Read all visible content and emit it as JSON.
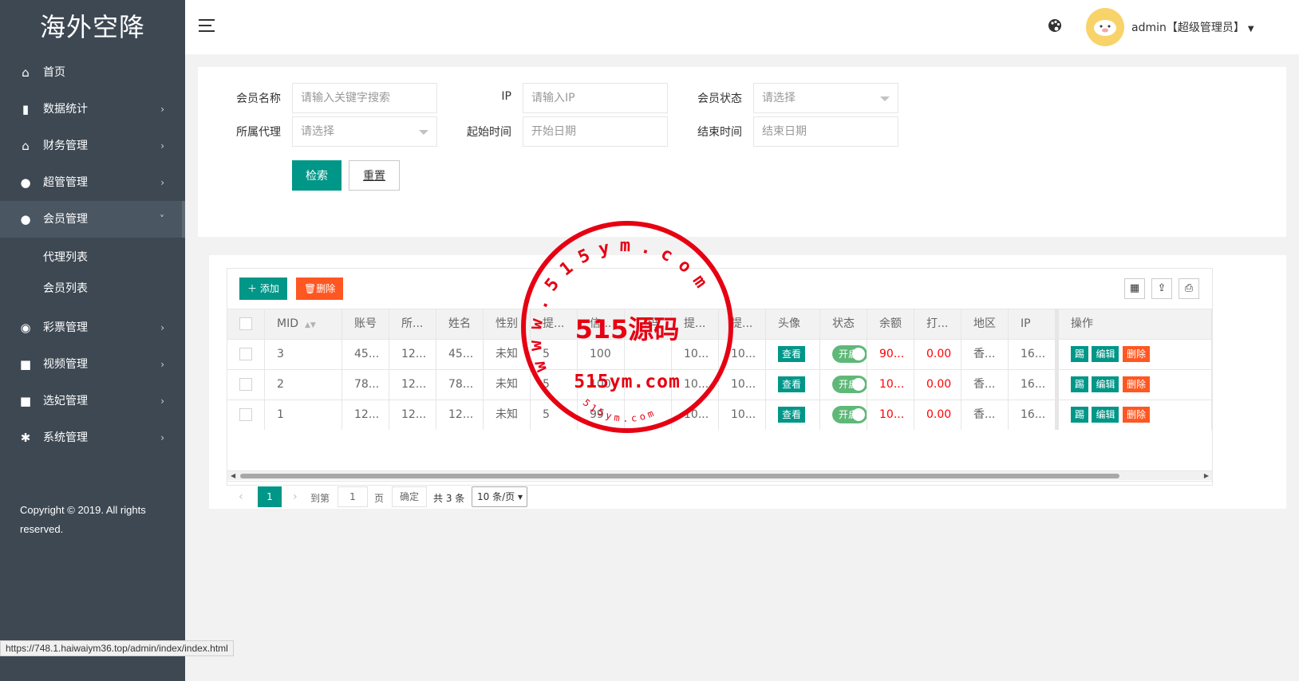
{
  "sidebar": {
    "brand": "海外空降",
    "items": [
      {
        "label": "首页",
        "icon": "home-icon",
        "glyph": "⌂"
      },
      {
        "label": "数据统计",
        "icon": "bar-chart-icon",
        "glyph": "▮"
      },
      {
        "label": "财务管理",
        "icon": "bank-icon",
        "glyph": "⌂"
      },
      {
        "label": "超管管理",
        "icon": "user-icon",
        "glyph": "●"
      },
      {
        "label": "会员管理",
        "icon": "users-icon",
        "glyph": "●"
      },
      {
        "label": "彩票管理",
        "icon": "gamepad-icon",
        "glyph": "◉"
      },
      {
        "label": "视频管理",
        "icon": "video-icon",
        "glyph": "■"
      },
      {
        "label": "选妃管理",
        "icon": "video-icon",
        "glyph": "■"
      },
      {
        "label": "系统管理",
        "icon": "gear-icon",
        "glyph": "✱"
      }
    ],
    "sub_items": [
      "代理列表",
      "会员列表"
    ],
    "copyright": "Copyright © 2019. All rights reserved."
  },
  "topbar": {
    "user": "admin【超级管理员】"
  },
  "search": {
    "member_name_label": "会员名称",
    "member_name_placeholder": "请输入关键字搜索",
    "ip_label": "IP",
    "ip_placeholder": "请输入IP",
    "status_label": "会员状态",
    "status_value": "请选择",
    "agent_label": "所属代理",
    "agent_value": "请选择",
    "start_label": "起始时间",
    "start_placeholder": "开始日期",
    "end_label": "结束时间",
    "end_placeholder": "结束日期",
    "search_button": "检索",
    "reset_button": "重置"
  },
  "table": {
    "add_button": "添加",
    "delete_button": "删除",
    "columns": [
      "MID",
      "账号",
      "所...",
      "姓名",
      "性别",
      "提...",
      "信...",
      "...码",
      "提...",
      "提...",
      "头像",
      "状态",
      "余额",
      "打...",
      "地区",
      "IP",
      "操作"
    ],
    "rows": [
      {
        "mid": "3",
        "account": "45...",
        "agent": "12...",
        "name": "45...",
        "gender": "未知",
        "c5": "5",
        "credit": "100",
        "c7": "",
        "c8": "10...",
        "c9": "10...",
        "avatar_btn": "查看",
        "status": "开启",
        "balance": "90...",
        "bet": "0.00",
        "region": "香...",
        "ip": "16..."
      },
      {
        "mid": "2",
        "account": "78...",
        "agent": "12...",
        "name": "78...",
        "gender": "未知",
        "c5": "5",
        "credit": "100",
        "c7": "",
        "c8": "10...",
        "c9": "10...",
        "avatar_btn": "查看",
        "status": "开启",
        "balance": "10...",
        "bet": "0.00",
        "region": "香...",
        "ip": "16..."
      },
      {
        "mid": "1",
        "account": "12...",
        "agent": "12...",
        "name": "12...",
        "gender": "未知",
        "c5": "5",
        "credit": "99",
        "c7": "",
        "c8": "10...",
        "c9": "10...",
        "avatar_btn": "查看",
        "status": "开启",
        "balance": "10...",
        "bet": "0.00",
        "region": "香...",
        "ip": "16..."
      }
    ],
    "row_actions": [
      "踢",
      "编辑",
      "删除"
    ]
  },
  "pager": {
    "current": "1",
    "goto_label": "到第",
    "page_input": "1",
    "page_unit": "页",
    "confirm": "确定",
    "total": "共 3 条",
    "page_size": "10 条/页"
  },
  "watermark": {
    "ring_text": "www.515ym.com",
    "main_text": "515源码",
    "sub_text": "515ym.com",
    "small_text": "515ym.com",
    "color": "#e60012"
  },
  "statusbar": {
    "url": "https://748.1.haiwaiym36.top/admin/index/index.html"
  }
}
